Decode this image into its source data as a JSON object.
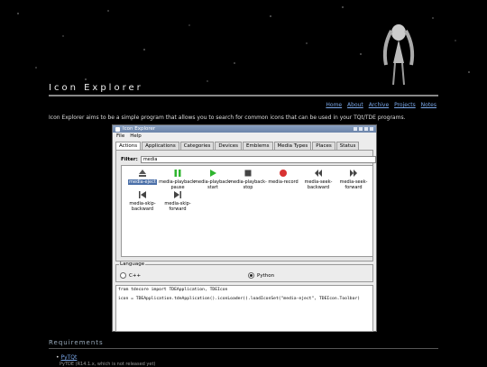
{
  "site": {
    "title": "Icon Explorer",
    "nav": [
      "Home",
      "About",
      "Archive",
      "Projects",
      "Notes"
    ],
    "intro": "Icon Explorer aims to be a simple program that allows you to search for common icons that can be used in your TQt/TDE programs."
  },
  "window": {
    "title": "Icon Explorer",
    "menu": [
      "File",
      "Help"
    ],
    "tabs": [
      "Actions",
      "Applications",
      "Categories",
      "Devices",
      "Emblems",
      "Media Types",
      "Places",
      "Status"
    ],
    "active_tab": "Actions",
    "filter_label": "Filter:",
    "filter_value": "media",
    "icons": [
      {
        "name": "media-eject",
        "icon": "eject-icon",
        "color": "#555555",
        "selected": true
      },
      {
        "name": "media-playback-pause",
        "icon": "pause-icon",
        "color": "#2fb52f"
      },
      {
        "name": "media-playback-start",
        "icon": "play-icon",
        "color": "#2fb52f"
      },
      {
        "name": "media-playback-stop",
        "icon": "stop-icon",
        "color": "#444444"
      },
      {
        "name": "media-record",
        "icon": "record-icon",
        "color": "#d83232"
      },
      {
        "name": "media-seek-backward",
        "icon": "rewind-icon",
        "color": "#444444"
      },
      {
        "name": "media-seek-forward",
        "icon": "fast-forward-icon",
        "color": "#444444"
      },
      {
        "name": "media-skip-backward",
        "icon": "skip-back-icon",
        "color": "#444444"
      },
      {
        "name": "media-skip-forward",
        "icon": "skip-forward-icon",
        "color": "#444444"
      }
    ],
    "language": {
      "label": "Language",
      "options": [
        "C++",
        "Python"
      ],
      "selected": "Python"
    },
    "code": "from tdecore import TDEApplication, TDEIcon\n\nicon = TDEApplication.tdeApplication().iconLoader().loadIconSet(\"media-eject\", TDEIcon.Toolbar)"
  },
  "requirements": {
    "heading": "Requirements",
    "items": [
      "PyTQt"
    ],
    "sub": "PyTDE (R14.1.x, which is not released yet)"
  }
}
